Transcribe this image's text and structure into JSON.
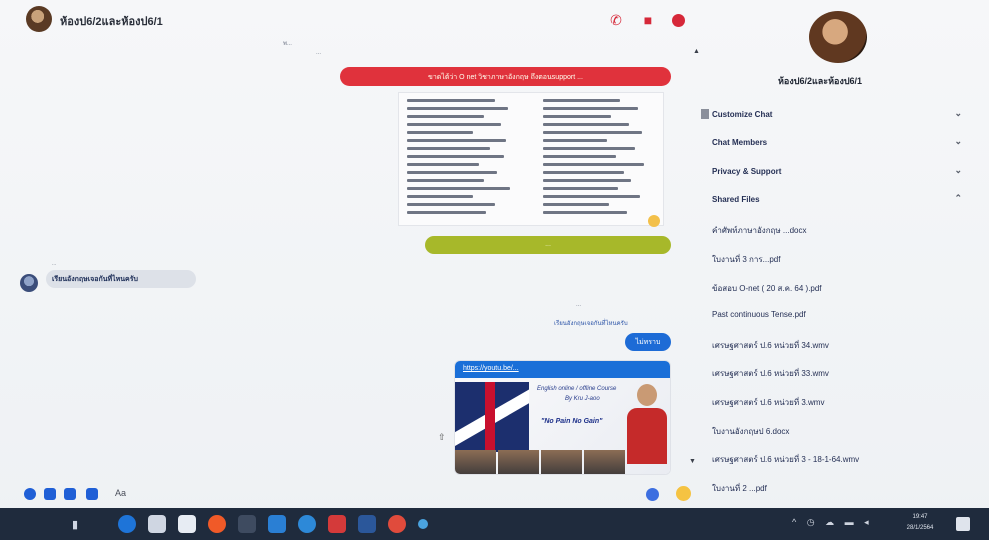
{
  "header": {
    "title": "ห้องป6/2และห้องป6/1"
  },
  "chat": {
    "meta_top_1": "พ...",
    "meta_top_2": "...",
    "red_bubble": "ขาดไต้ว่า O net วิชาภาษาอังกฤษ ถึงตอนsupport ...",
    "olive_bubble": "...",
    "sender_label": "...",
    "received_message": "เรียนอังกฤษเจอกันที่ไหนครับ",
    "reply_meta_1": "...",
    "reply_meta_2": "เรียนอังกฤษเจอกันที่ไหนครับ",
    "blue_reply": "ไม่ทราบ",
    "link_url": "https://youtu.be/...",
    "card_line1": "English online / offline Course",
    "card_line2": "By Kru J-aoo",
    "card_slogan": "\"No Pain No Gain\""
  },
  "composer": {
    "aa": "Aa"
  },
  "panel": {
    "name": "ห้องป6/2และห้องป6/1",
    "customize": "Customize Chat",
    "members": "Chat Members",
    "privacy": "Privacy & Support",
    "shared": "Shared Files",
    "files": [
      "คำศัพท์ภาษาอังกฤษ ...docx",
      "ใบงานที่ 3 การ...pdf",
      "ข้อสอบ O-net ( 20 ส.ค. 64 ).pdf",
      "Past continuous Tense.pdf",
      "เศรษฐศาสตร์ ป.6 หน่วยที่ 34.wmv",
      "เศรษฐศาสตร์ ป.6 หน่วยที่ 33.wmv",
      "เศรษฐศาสตร์ ป.6 หน่วยที่ 3.wmv",
      "ใบงานอังกฤษป 6.docx",
      "เศรษฐศาสตร์ ป.6 หน่วยที่ 3 - 18-1-64.wmv",
      "ใบงานที่ 2 ...pdf"
    ]
  },
  "taskbar": {
    "time": "19:47",
    "date": "28/1/2564"
  },
  "colors": {
    "accent_red": "#d62839",
    "messenger_blue": "#1d6bd6",
    "olive": "#a7b82a",
    "taskbar": "#1f2b3d"
  }
}
